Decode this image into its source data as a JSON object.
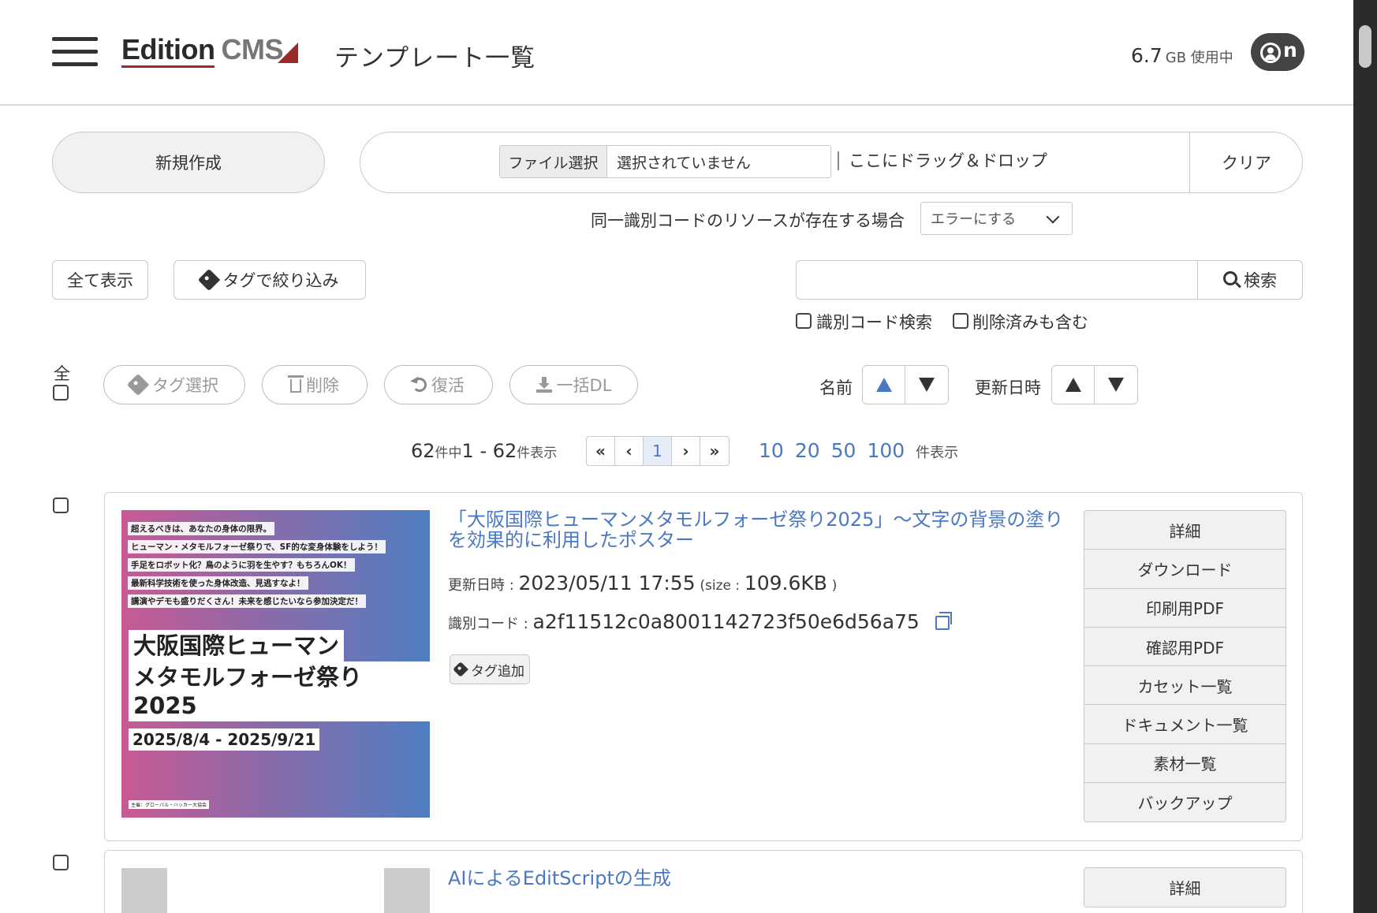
{
  "header": {
    "logo_edition": "Edition",
    "logo_cms": "CMS",
    "page_title": "テンプレート一覧",
    "usage_value": "6.7",
    "usage_unit": "GB 使用中",
    "user_initial": "n"
  },
  "toolbar": {
    "new_label": "新規作成",
    "file_choose_label": "ファイル選択",
    "file_status": "選択されていません",
    "drop_label": "ここにドラッグ＆ドロップ",
    "clear_label": "クリア",
    "duplicate_label": "同一識別コードのリソースが存在する場合",
    "duplicate_selected": "エラーにする"
  },
  "filter": {
    "show_all_label": "全て表示",
    "tag_filter_label": "タグで絞り込み",
    "search_placeholder": "",
    "search_label": "検索",
    "code_search_label": "識別コード検索",
    "include_deleted_label": "削除済みも含む"
  },
  "actions": {
    "select_all_label": "全",
    "tag_select_label": "タグ選択",
    "delete_label": "削除",
    "restore_label": "復活",
    "bulk_dl_label": "一括DL",
    "sort_name_label": "名前",
    "sort_updated_label": "更新日時"
  },
  "pagination": {
    "total": "62",
    "total_suffix": "件中",
    "range": "1 - 62",
    "range_suffix": "件表示",
    "current_page": "1",
    "per_page_options": [
      "10",
      "20",
      "50",
      "100"
    ],
    "per_page_suffix": "件表示"
  },
  "items": [
    {
      "title": "「大阪国際ヒューマンメタモルフォーゼ祭り2025」〜文字の背景の塗りを効果的に利用したポスター",
      "updated_label": "更新日時 :",
      "updated_value": "2023/05/11 17:55",
      "size_label": "(size :",
      "size_value": "109.6KB",
      "size_close": ")",
      "code_label": "識別コード :",
      "code_value": "a2f11512c0a8001142723f50e6d56a75",
      "tag_add_label": "タグ追加",
      "thumbnail": {
        "lines": [
          "超えるべきは、あなたの身体の限界。",
          "ヒューマン・メタモルフォーゼ祭りで、SF的な変身体験をしよう！",
          "手足をロボット化？鳥のように羽を生やす？もちろんOK！",
          "最新科学技術を使った身体改造、見逃すなよ！",
          "講演やデモも盛りだくさん！未来を感じたいなら参加決定だ！"
        ],
        "title_line1": "大阪国際ヒューマン",
        "title_line2": "メタモルフォーゼ祭り2025",
        "dates": "2025/8/4 - 2025/9/21",
        "organizer": "主催：グローバル・ハッカー大協会"
      },
      "menu": [
        "詳細",
        "ダウンロード",
        "印刷用PDF",
        "確認用PDF",
        "カセット一覧",
        "ドキュメント一覧",
        "素材一覧",
        "バックアップ"
      ]
    },
    {
      "title": "AIによるEditScriptの生成",
      "menu": [
        "詳細"
      ]
    }
  ],
  "colors": {
    "link": "#4a78c2",
    "brand_red": "#9b2a2a",
    "header_dark": "#444444"
  }
}
